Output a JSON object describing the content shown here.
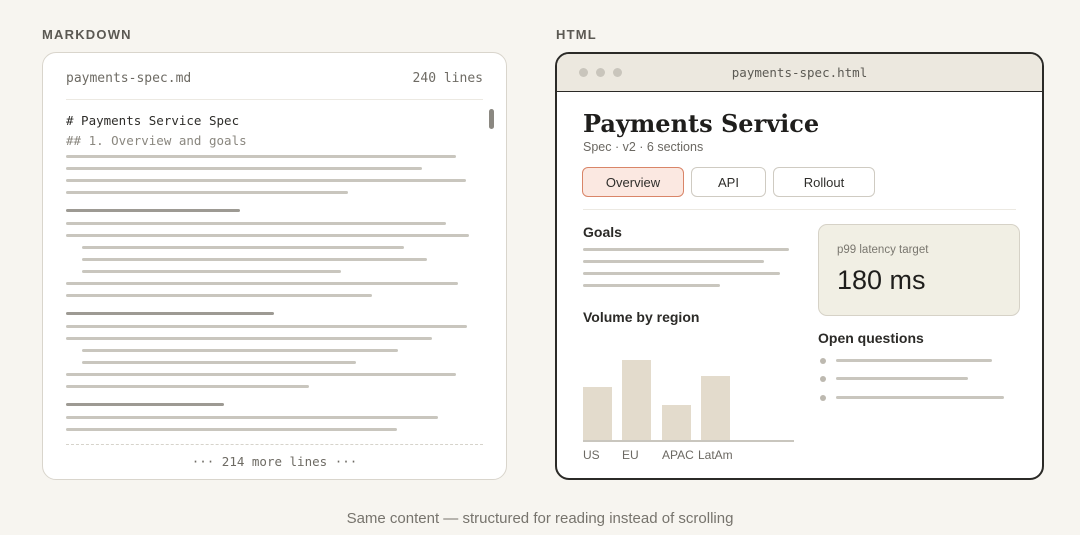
{
  "labels": {
    "markdown": "MARKDOWN",
    "html": "HTML"
  },
  "markdown_panel": {
    "filename": "payments-spec.md",
    "line_count": "240 lines",
    "heading1": "# Payments Service Spec",
    "heading2": "## 1. Overview and goals",
    "more_lines": "··· 214 more lines ···"
  },
  "html_panel": {
    "window_title": "payments-spec.html",
    "page_title": "Payments Service",
    "subtitle": "Spec · v2 · 6 sections",
    "tabs": [
      {
        "label": "Overview",
        "active": true
      },
      {
        "label": "API",
        "active": false
      },
      {
        "label": "Rollout",
        "active": false
      }
    ],
    "goals_heading": "Goals",
    "metric": {
      "label": "p99 latency target",
      "value": "180 ms"
    },
    "chart_heading": "Volume by region",
    "open_questions_heading": "Open questions"
  },
  "chart_data": {
    "type": "bar",
    "categories": [
      "US",
      "EU",
      "APAC",
      "LatAm"
    ],
    "values": [
      53,
      80,
      35,
      64
    ],
    "title": "Volume by region",
    "xlabel": "",
    "ylabel": "",
    "ylim": [
      0,
      100
    ],
    "color": "#e3dbcc"
  },
  "caption": "Same content — structured for reading instead of scrolling",
  "colors": {
    "background": "#f7f5f0",
    "active_tab": "#fbe8e1",
    "active_tab_border": "#d98568",
    "metric_card": "#f1efe4",
    "bar": "#e3dbcc",
    "text_line": "#c9c6be"
  }
}
